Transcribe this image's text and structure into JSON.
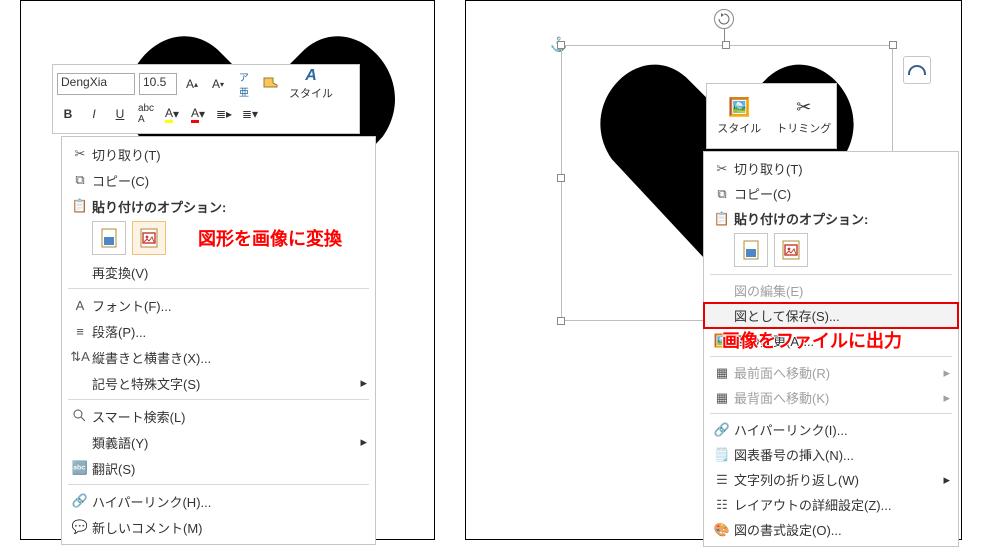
{
  "left": {
    "mini": {
      "font": "DengXia",
      "size": "10.5",
      "style_label": "スタイル",
      "row2": {
        "b": "B",
        "i": "I",
        "u": "U"
      }
    },
    "context": {
      "cut": "切り取り(T)",
      "copy": "コピー(C)",
      "paste_hdr": "貼り付けのオプション:",
      "reconv": "再変換(V)",
      "font": "フォント(F)...",
      "para": "段落(P)...",
      "vert": "縦書きと横書き(X)...",
      "symbol": "記号と特殊文字(S)",
      "smart": "スマート検索(L)",
      "thes": "類義語(Y)",
      "trans": "翻訳(S)",
      "link": "ハイパーリンク(H)...",
      "comment": "新しいコメント(M)"
    },
    "callout": "図形を画像に変換"
  },
  "right": {
    "pic_tb": {
      "style": "スタイル",
      "crop": "トリミング"
    },
    "context": {
      "cut": "切り取り(T)",
      "copy": "コピー(C)",
      "paste_hdr": "貼り付けのオプション:",
      "edit": "図の編集(E)",
      "saveas": "図として保存(S)...",
      "change": "図の変更(A)...",
      "front": "最前面へ移動(R)",
      "back": "最背面へ移動(K)",
      "link": "ハイパーリンク(I)...",
      "caption": "図表番号の挿入(N)...",
      "wrap": "文字列の折り返し(W)",
      "layout": "レイアウトの詳細設定(Z)...",
      "format": "図の書式設定(O)..."
    },
    "callout": "画像をファイルに出力"
  }
}
